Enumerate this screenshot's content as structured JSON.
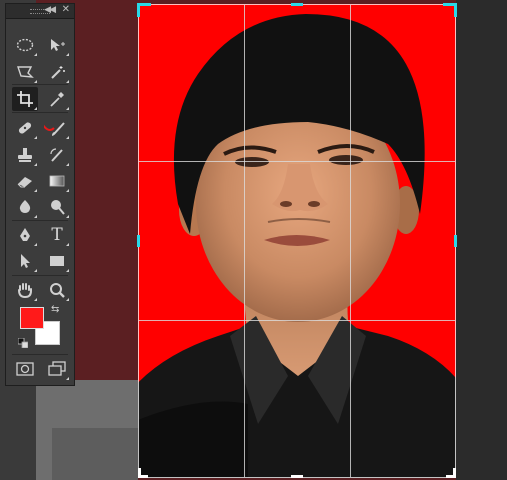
{
  "canvas": {
    "background_color": "#5b1f22",
    "photo_background_color": "#ff0000"
  },
  "crop_overlay": {
    "handle_color": "#29d8e8",
    "grid_rows": 3,
    "grid_cols": 3
  },
  "tools_panel": {
    "header": {
      "collapse_icon": "double-chevron-left-icon",
      "close_icon": "close-icon"
    },
    "tools": [
      {
        "name": "elliptical-marquee-tool",
        "icon": "ellipse-dashed-icon"
      },
      {
        "name": "move-tool",
        "icon": "move-arrow-icon"
      },
      {
        "name": "polygonal-lasso-tool",
        "icon": "lasso-icon"
      },
      {
        "name": "magic-wand-tool",
        "icon": "magic-wand-icon"
      },
      {
        "name": "crop-tool",
        "icon": "crop-icon",
        "active": true
      },
      {
        "name": "eyedropper-tool",
        "icon": "eyedropper-icon"
      },
      {
        "name": "spot-healing-brush-tool",
        "icon": "bandage-icon"
      },
      {
        "name": "brush-tool",
        "icon": "brush-icon"
      },
      {
        "name": "clone-stamp-tool",
        "icon": "stamp-icon"
      },
      {
        "name": "history-brush-tool",
        "icon": "history-brush-icon"
      },
      {
        "name": "eraser-tool",
        "icon": "eraser-icon"
      },
      {
        "name": "gradient-tool",
        "icon": "gradient-icon"
      },
      {
        "name": "blur-tool",
        "icon": "blur-drop-icon"
      },
      {
        "name": "dodge-tool",
        "icon": "dodge-icon"
      },
      {
        "name": "pen-tool",
        "icon": "pen-icon"
      },
      {
        "name": "type-tool",
        "icon": "type-icon",
        "glyph": "T"
      },
      {
        "name": "path-selection-tool",
        "icon": "arrow-select-icon"
      },
      {
        "name": "rectangle-tool",
        "icon": "rectangle-icon"
      },
      {
        "name": "hand-tool",
        "icon": "hand-icon"
      },
      {
        "name": "zoom-tool",
        "icon": "zoom-icon"
      },
      {
        "name": "quick-mask-mode",
        "icon": "quick-mask-icon"
      },
      {
        "name": "screen-mode",
        "icon": "screen-mode-icon"
      }
    ],
    "colors": {
      "foreground": "#ff1a1a",
      "background": "#ffffff"
    }
  }
}
